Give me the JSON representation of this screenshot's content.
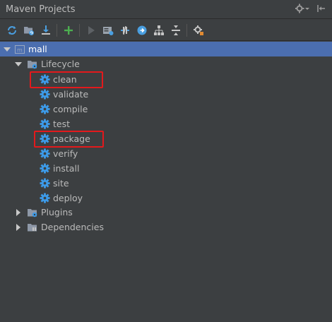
{
  "window": {
    "title": "Maven Projects",
    "settings_icon": "gear-dropdown-icon",
    "hide_icon": "pin-hide-icon"
  },
  "toolbar": {
    "buttons": [
      {
        "name": "reimport-icon"
      },
      {
        "name": "generate-sources-icon"
      },
      {
        "name": "download-sources-icon"
      },
      {
        "name": "add-maven-project-icon"
      },
      {
        "name": "run-maven-build-icon"
      },
      {
        "name": "execute-goal-icon"
      },
      {
        "name": "toggle-offline-icon"
      },
      {
        "name": "skip-tests-icon"
      },
      {
        "name": "show-dependencies-icon"
      },
      {
        "name": "collapse-all-icon"
      },
      {
        "name": "maven-settings-icon"
      }
    ]
  },
  "tree": {
    "root": {
      "label": "mall",
      "expanded": true,
      "selected": true
    },
    "lifecycle": {
      "label": "Lifecycle",
      "expanded": true,
      "goals": [
        "clean",
        "validate",
        "compile",
        "test",
        "package",
        "verify",
        "install",
        "site",
        "deploy"
      ]
    },
    "plugins": {
      "label": "Plugins",
      "expanded": false
    },
    "dependencies": {
      "label": "Dependencies",
      "expanded": false
    },
    "highlighted_goals": [
      "clean",
      "package"
    ]
  },
  "colors": {
    "background": "#3c3f41",
    "selection": "#4b6eaf",
    "highlight_box": "#e3191c",
    "gear": "#3d9be9"
  }
}
